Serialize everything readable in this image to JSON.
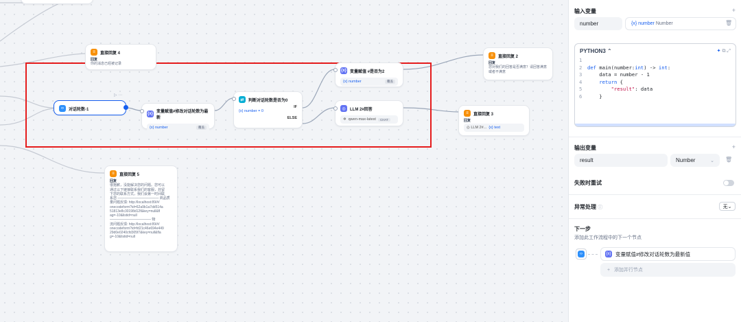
{
  "canvas": {
    "nodes": {
      "reply4": {
        "title": "直接回复 4",
        "label": "回复",
        "text": "你的消息已经被记录"
      },
      "counter": {
        "title": "对话轮数-1"
      },
      "assign_counter": {
        "title": "变量赋值#修改对话轮数为最新",
        "var": "number",
        "tag": "覆盖"
      },
      "check_zero": {
        "title": "判断对话轮数是否为0",
        "if_label": "IF",
        "else_label": "ELSE",
        "cond": "number = 0"
      },
      "assign_satisfied": {
        "title": "变量赋值 #是否为2",
        "var": "number",
        "tag": "覆盖"
      },
      "llm": {
        "title": "LLM 2#回答",
        "model": "qwen-max-latest",
        "model_tag": "CHAT"
      },
      "reply2": {
        "title": "直接回复 2",
        "label": "回复",
        "text": "您对我们的回答是否满意？请回答满意 或者不满意"
      },
      "reply3": {
        "title": "直接回复 3",
        "label": "回复",
        "var_a": "LLM 2#...",
        "var_b": "text"
      },
      "reply5": {
        "title": "直接回复 5",
        "label": "回复",
        "lines": [
          "很抱歉，没能解决您的问题。您可以",
          "通过以下链接联系我们的客服，并留",
          "下您的联系方式，我们会第一时间联",
          "系您 ———————————— 商品质",
          "量问题反馈: http://localhost:89/#/",
          "onecodeform?id=62a9b1a7dd514a",
          "51813e8c30198d12f&key=null&fl",
          "ag=-10&listid=null",
          "———————————— 物",
          "流问题反馈: http://localhost:89/#/",
          "onecodeform?id=fd21c46e694e449",
          "29d0e0240cfd305f7&key=null&fla",
          "g=-10&listid=null"
        ]
      }
    }
  },
  "panel": {
    "input_title": "输入变量",
    "input_name": "number",
    "input_ref_var": "number",
    "input_ref_type": "Number",
    "code_lang": "PYTHON3",
    "code_lines": [
      "",
      "def main(number:int) -> int:",
      "    data = number - 1",
      "    return {",
      "        \"result\": data",
      "    }"
    ],
    "output_title": "输出变量",
    "output_name": "result",
    "output_type": "Number",
    "retry_label": "失败时重试",
    "error_label": "异常处理",
    "error_value": "无",
    "next_title": "下一步",
    "next_desc": "添加此工作流程中的下一个节点",
    "next_node": "变量赋值#修改对话轮数为最新值",
    "add_parallel": "添加并行节点"
  }
}
